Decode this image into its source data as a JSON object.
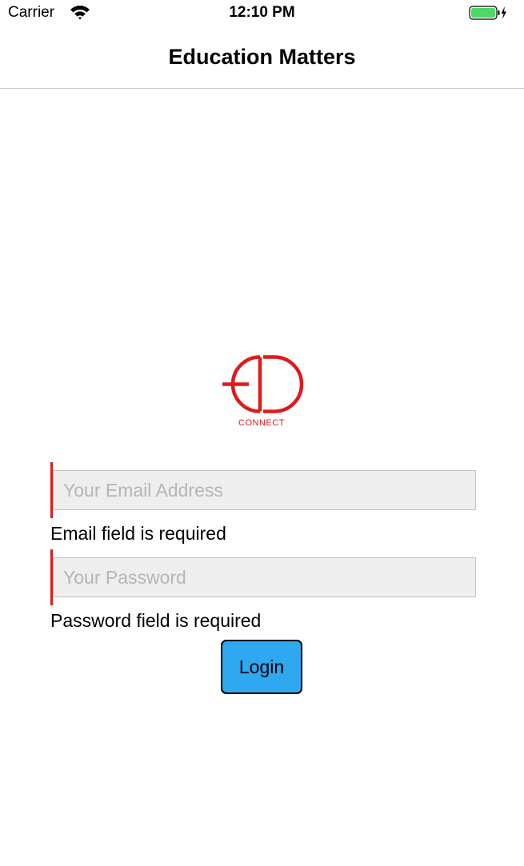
{
  "status_bar": {
    "carrier": "Carrier",
    "time": "12:10 PM",
    "battery_color": "#4cd964"
  },
  "nav": {
    "title": "Education Matters"
  },
  "logo": {
    "letters": "ED",
    "caption": "CONNECT",
    "color": "#e01a1a"
  },
  "form": {
    "email": {
      "placeholder": "Your Email Address",
      "value": "",
      "error": "Email field is required"
    },
    "password": {
      "placeholder": "Your Password",
      "value": "",
      "error": "Password field is required"
    },
    "login_label": "Login",
    "error_color": "#e01a1a",
    "button_color": "#2ea8f0"
  }
}
